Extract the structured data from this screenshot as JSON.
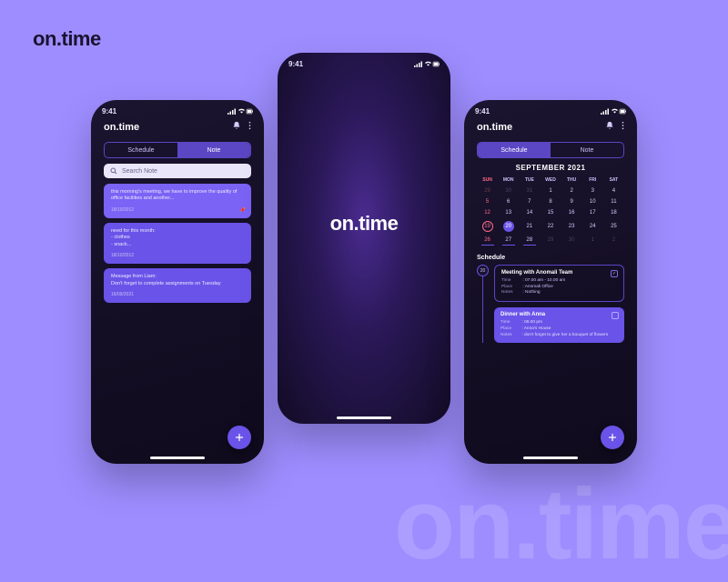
{
  "brand": "on.time",
  "watermark": "on.time",
  "status_time": "9:41",
  "tabs": {
    "schedule": "Schedule",
    "note": "Note"
  },
  "search_placeholder": "Search Note",
  "notes": [
    {
      "body": "this morning's meeting, we have to improve the quality of office facilities and another...",
      "date": "18/10/2012",
      "pinned": true
    },
    {
      "body": "need for this month:\n- clothes\n- snack...",
      "date": "18/10/2012",
      "pinned": false
    },
    {
      "body": "Message from Liam:\nDon't forget to complete assignments on Tuesday",
      "date": "16/09/2021",
      "pinned": false
    }
  ],
  "calendar": {
    "title": "SEPTEMBER 2021",
    "dow": [
      "SUN",
      "MON",
      "TUE",
      "WED",
      "THU",
      "FRI",
      "SAT"
    ],
    "weeks": [
      [
        {
          "n": 29,
          "muted": true,
          "sun": true
        },
        {
          "n": 30,
          "muted": true
        },
        {
          "n": 31,
          "muted": true
        },
        {
          "n": 1
        },
        {
          "n": 2
        },
        {
          "n": 3
        },
        {
          "n": 4
        }
      ],
      [
        {
          "n": 5,
          "sun": true
        },
        {
          "n": 6
        },
        {
          "n": 7
        },
        {
          "n": 8
        },
        {
          "n": 9
        },
        {
          "n": 10
        },
        {
          "n": 11
        }
      ],
      [
        {
          "n": 12,
          "sun": true
        },
        {
          "n": 13
        },
        {
          "n": 14
        },
        {
          "n": 15
        },
        {
          "n": 16
        },
        {
          "n": 17
        },
        {
          "n": 18
        }
      ],
      [
        {
          "n": 19,
          "sun": true,
          "selected": true
        },
        {
          "n": 20,
          "today": true
        },
        {
          "n": 21
        },
        {
          "n": 22
        },
        {
          "n": 23
        },
        {
          "n": 24
        },
        {
          "n": 25
        }
      ],
      [
        {
          "n": 26,
          "sun": true,
          "has": true
        },
        {
          "n": 27,
          "has": true
        },
        {
          "n": 28,
          "has": true
        },
        {
          "n": 29,
          "muted": true
        },
        {
          "n": 30,
          "muted": true
        },
        {
          "n": 1,
          "muted": true
        },
        {
          "n": 2,
          "muted": true
        }
      ]
    ]
  },
  "schedule_heading": "Schedule",
  "timeline_day": "20",
  "events": [
    {
      "title": "Meeting with Anomali Team",
      "time": "07.00 am - 10.00 am",
      "place": "Anomali Office",
      "notes": "Nothing",
      "checked": true,
      "style": "outline"
    },
    {
      "title": "Dinner with Anna",
      "time": "08.00 pm",
      "place": "Anna's House",
      "notes": "don't forget to give her a bouquet of flowers",
      "checked": false,
      "style": "filled"
    }
  ],
  "labels": {
    "time": "Time",
    "place": "Place",
    "notes": "Notes"
  }
}
